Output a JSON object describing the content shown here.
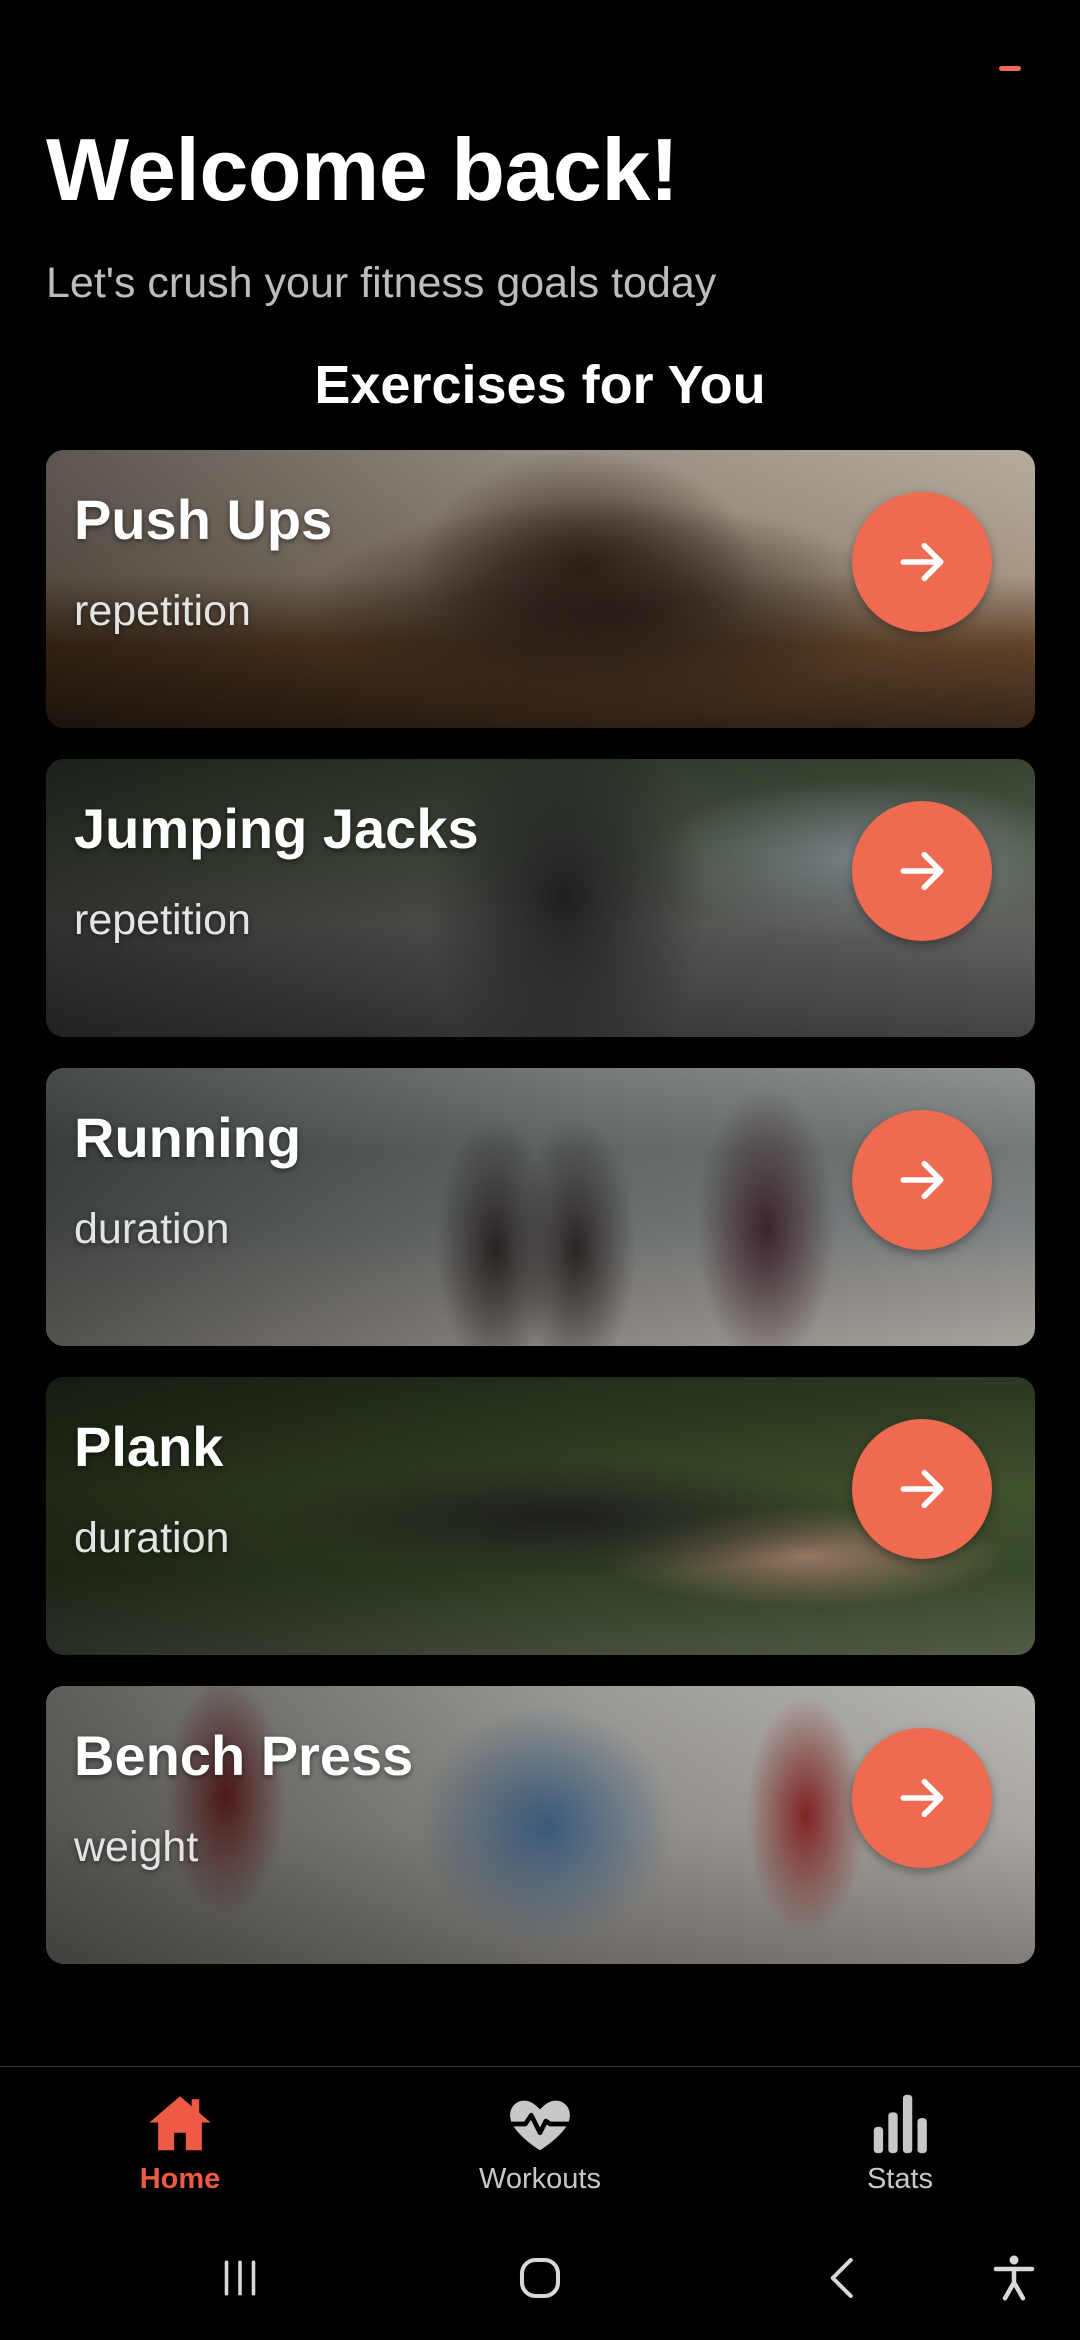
{
  "header": {
    "title": "Welcome back!",
    "subtitle": "Let's crush your fitness goals today",
    "section_title": "Exercises for You"
  },
  "exercises": [
    {
      "name": "Push Ups",
      "type": "repetition",
      "icon": "arrow-right-icon"
    },
    {
      "name": "Jumping Jacks",
      "type": "repetition",
      "icon": "arrow-right-icon"
    },
    {
      "name": "Running",
      "type": "duration",
      "icon": "arrow-right-icon"
    },
    {
      "name": "Plank",
      "type": "duration",
      "icon": "arrow-right-icon"
    },
    {
      "name": "Bench Press",
      "type": "weight",
      "icon": "arrow-right-icon"
    }
  ],
  "bottom_nav": {
    "items": [
      {
        "label": "Home",
        "icon": "home-icon",
        "active": true
      },
      {
        "label": "Workouts",
        "icon": "heart-pulse-icon",
        "active": false
      },
      {
        "label": "Stats",
        "icon": "bar-chart-icon",
        "active": false
      }
    ]
  },
  "system_nav": {
    "buttons": [
      "recents-icon",
      "home-circle-icon",
      "back-icon",
      "accessibility-icon"
    ]
  },
  "colors": {
    "accent": "#ee6a50",
    "active_nav": "#ee5a45",
    "background": "#000000",
    "subtitle": "#bdbdbd"
  }
}
